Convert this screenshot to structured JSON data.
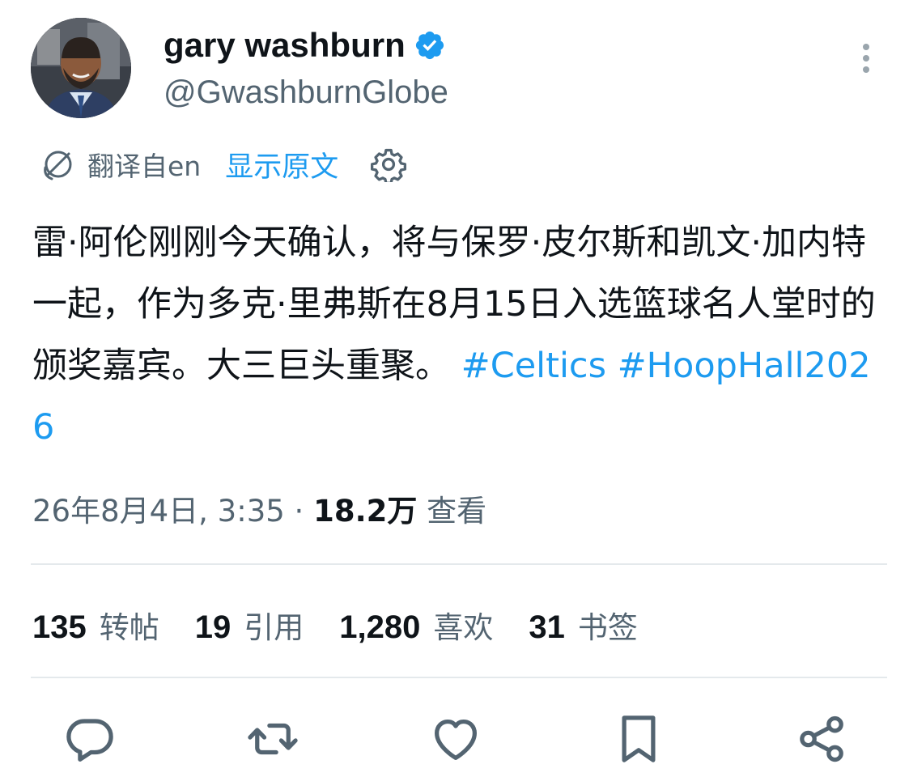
{
  "author": {
    "display_name": "gary washburn",
    "handle": "@GwashburnGlobe",
    "verified": true
  },
  "translation": {
    "translated_from": "翻译自en",
    "show_original_label": "显示原文"
  },
  "tweet": {
    "text": "雷·阿伦刚刚今天确认，将与保罗·皮尔斯和凯文·加内特一起，作为多克·里弗斯在8月15日入选篮球名人堂时的颁奖嘉宾。大三巨头重聚。",
    "hashtags": [
      "#Celtics",
      "#HoopHall2026"
    ]
  },
  "meta": {
    "timestamp": "26年8月4日, 3:35",
    "separator": " · ",
    "views_count": "18.2万",
    "views_label": "查看"
  },
  "stats": {
    "retweets": {
      "count": "135",
      "label": "转帖"
    },
    "quotes": {
      "count": "19",
      "label": "引用"
    },
    "likes": {
      "count": "1,280",
      "label": "喜欢"
    },
    "bookmarks": {
      "count": "31",
      "label": "书签"
    }
  },
  "colors": {
    "link": "#1d9bf0",
    "secondary_text": "#536471",
    "primary_text": "#0f1419",
    "divider": "#e4e9ec"
  },
  "icons": [
    "verified-badge-icon",
    "more-options-icon",
    "translate-icon",
    "settings-icon",
    "reply-icon",
    "retweet-icon",
    "like-icon",
    "bookmark-icon",
    "share-icon"
  ]
}
